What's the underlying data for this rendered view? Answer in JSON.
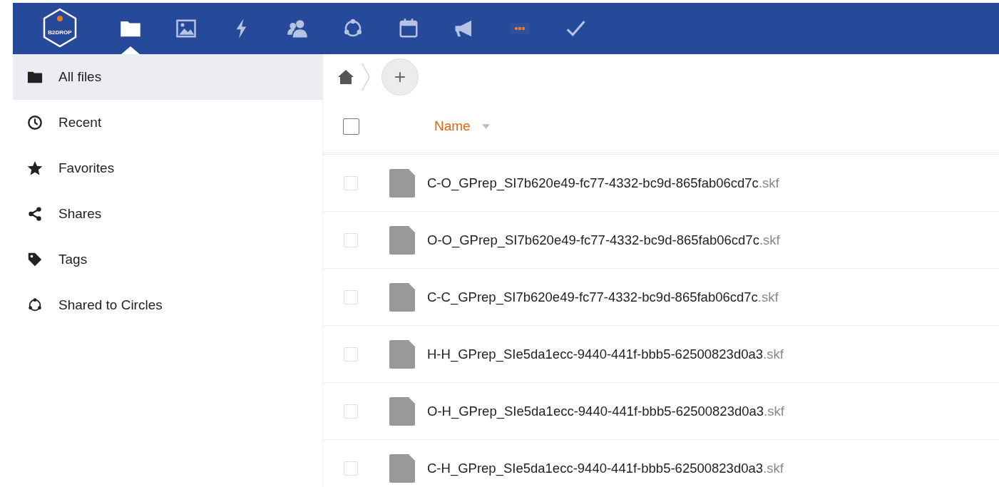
{
  "header": {
    "logo_text": "B2DROP",
    "apps": [
      {
        "kind": "files",
        "selected": true
      },
      {
        "kind": "gallery",
        "selected": false
      },
      {
        "kind": "activity",
        "selected": false
      },
      {
        "kind": "contacts",
        "selected": false
      },
      {
        "kind": "circles",
        "selected": false
      },
      {
        "kind": "calendar",
        "selected": false
      },
      {
        "kind": "announcements",
        "selected": false
      },
      {
        "kind": "custom",
        "selected": false
      },
      {
        "kind": "tasks",
        "selected": false
      }
    ]
  },
  "sidebar": {
    "items": [
      {
        "kind": "folder",
        "label": "All files",
        "selected": true
      },
      {
        "kind": "clock",
        "label": "Recent",
        "selected": false
      },
      {
        "kind": "star",
        "label": "Favorites",
        "selected": false
      },
      {
        "kind": "share",
        "label": "Shares",
        "selected": false
      },
      {
        "kind": "tag",
        "label": "Tags",
        "selected": false
      },
      {
        "kind": "circles",
        "label": "Shared to Circles",
        "selected": false
      }
    ]
  },
  "breadcrumb": {
    "new_button": "+"
  },
  "table": {
    "columns": [
      {
        "label": "Name",
        "sorted": true
      }
    ],
    "select_all": {
      "checked": false
    },
    "rows": [
      {
        "name": "C-O_GPrep_SI7b620e49-fc77-4332-bc9d-865fab06cd7c",
        "ext": ".skf",
        "checked": false
      },
      {
        "name": "O-O_GPrep_SI7b620e49-fc77-4332-bc9d-865fab06cd7c",
        "ext": ".skf",
        "checked": false
      },
      {
        "name": "C-C_GPrep_SI7b620e49-fc77-4332-bc9d-865fab06cd7c",
        "ext": ".skf",
        "checked": false
      },
      {
        "name": "H-H_GPrep_SIe5da1ecc-9440-441f-bbb5-62500823d0a3",
        "ext": ".skf",
        "checked": false
      },
      {
        "name": "O-H_GPrep_SIe5da1ecc-9440-441f-bbb5-62500823d0a3",
        "ext": ".skf",
        "checked": false
      },
      {
        "name": "C-H_GPrep_SIe5da1ecc-9440-441f-bbb5-62500823d0a3",
        "ext": ".skf",
        "checked": false
      }
    ]
  }
}
